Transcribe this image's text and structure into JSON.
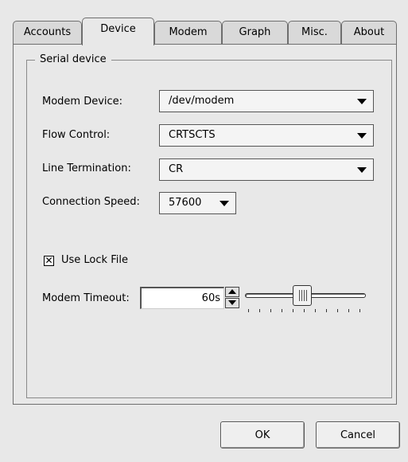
{
  "tabs": [
    "Accounts",
    "Device",
    "Modem",
    "Graph",
    "Misc.",
    "About"
  ],
  "active_tab": "Device",
  "group": {
    "title": "Serial device"
  },
  "fields": {
    "modem_device": {
      "label": "Modem Device:",
      "value": "/dev/modem"
    },
    "flow_control": {
      "label": "Flow Control:",
      "value": "CRTSCTS"
    },
    "line_termination": {
      "label": "Line Termination:",
      "value": "CR"
    },
    "connection_speed": {
      "label": "Connection Speed:",
      "value": "57600"
    }
  },
  "lock_file": {
    "label": "Use Lock File",
    "checked": true,
    "mark": "✕"
  },
  "modem_timeout": {
    "label": "Modem Timeout:",
    "value": "60s",
    "slider_fraction": 0.47
  },
  "buttons": {
    "ok": "OK",
    "cancel": "Cancel"
  }
}
